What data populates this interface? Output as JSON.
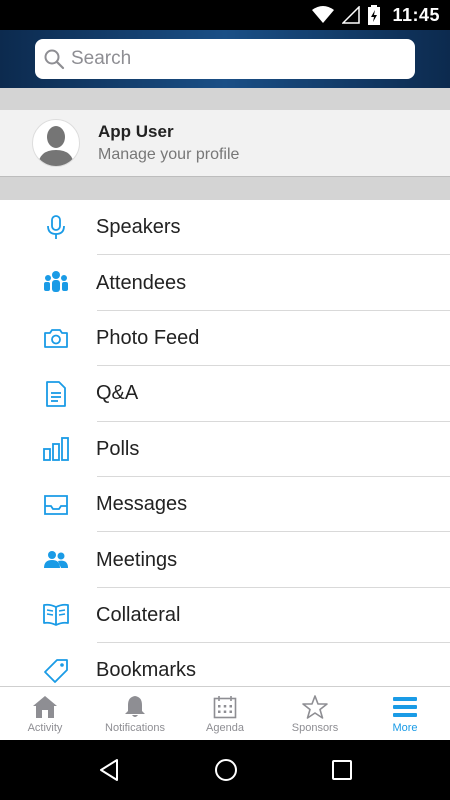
{
  "status_bar": {
    "time": "11:45"
  },
  "search": {
    "placeholder": "Search"
  },
  "profile": {
    "name": "App User",
    "subtitle": "Manage your profile"
  },
  "menu": [
    {
      "label": "Speakers",
      "icon": "microphone-icon"
    },
    {
      "label": "Attendees",
      "icon": "people-group-icon"
    },
    {
      "label": "Photo Feed",
      "icon": "camera-icon"
    },
    {
      "label": "Q&A",
      "icon": "document-icon"
    },
    {
      "label": "Polls",
      "icon": "bar-chart-icon"
    },
    {
      "label": "Messages",
      "icon": "inbox-icon"
    },
    {
      "label": "Meetings",
      "icon": "two-people-icon"
    },
    {
      "label": "Collateral",
      "icon": "open-book-icon"
    },
    {
      "label": "Bookmarks",
      "icon": "tag-icon"
    }
  ],
  "tabs": [
    {
      "label": "Activity",
      "icon": "home-icon"
    },
    {
      "label": "Notifications",
      "icon": "bell-icon"
    },
    {
      "label": "Agenda",
      "icon": "calendar-icon"
    },
    {
      "label": "Sponsors",
      "icon": "star-icon"
    },
    {
      "label": "More",
      "icon": "hamburger-menu-icon",
      "active": true
    }
  ],
  "colors": {
    "accent": "#1a9be6",
    "header": "#13406e",
    "inactive": "#8e8e93"
  }
}
